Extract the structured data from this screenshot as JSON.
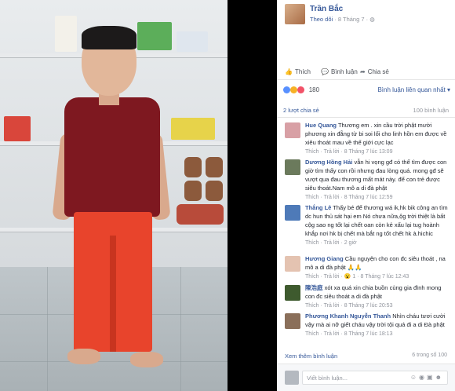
{
  "post": {
    "author": "Trần Bắc",
    "follow": "Theo dõi",
    "date": "· 8 Tháng 7 ·"
  },
  "actions": {
    "like": "Thích",
    "comment": "Bình luận",
    "share": "Chia sẻ"
  },
  "reactions": {
    "count": "180"
  },
  "sort_label": "Bình luận liên quan nhất",
  "shares": "2 lượt chia sẻ",
  "comment_total": "100 bình luận",
  "comments": [
    {
      "name": "Hue Quang",
      "text": "Thương em . xin cầu trời phật mười phương xin đẵng từ bi soi lối cho linh hồn em được về xiêu thoát mau về thế giới cực lạc",
      "foot": "Thích · Trả lời · 8 Tháng 7 lúc 13:09"
    },
    {
      "name": "Dương Hồng Hải",
      "text": "vẫn hi vọng gđ có thể tìm được con giờ tìm thấy con rồi nhưng đau lòng quá. mong gđ sẽ vượt qua đau thương mất mát này. để con trẻ được siêu thoát.Nam mô a di đà phật",
      "foot": "Thích · Trả lời · 8 Tháng 7 lúc 12:59"
    },
    {
      "name": "Thắng Lê",
      "text": "Thấy bé để thương wá ik,hk bik công an tìm dc hun thủ sát hại em Nó chưa nữa,ộg trời thiệt là bất cộg sao ng tốt lại chết oan còn kẻ xấu lại tug hoành khắp nơi hk bị chết mà bắt ng tốt chết hk à.hichic",
      "foot": "Thích · Trả lời · 2 giờ"
    },
    {
      "name": "Hương Giang",
      "text": "Cầu nguyện cho con đc siêu thoát , na mô a di đà phật 🙏🙏",
      "foot": "Thích · Trả lời · 😮 1 · 8 Tháng 7 lúc 12:43"
    },
    {
      "name": "陳浩庭",
      "text": "xót xa quá xin chia buồn cùng gia đình mong con đc siêu thoát a di đà phật",
      "foot": "Thích · Trả lời · 8 Tháng 7 lúc 20:53"
    },
    {
      "name": "Phương Khanh Nguyễn Thanh",
      "text": "Nhìn cháu tươi cười vậy mà ai nỡ giết cháu vậy trời tội quá đi a di Đà phật",
      "foot": "Thích · Trả lời · 8 Tháng 7 lúc 18:13"
    }
  ],
  "more_comments": "Xem thêm bình luận",
  "more_count": "6 trong số 100",
  "input": {
    "placeholder": "Viết bình luận..."
  },
  "colors": {
    "link": "#365899",
    "muted": "#90949c"
  }
}
